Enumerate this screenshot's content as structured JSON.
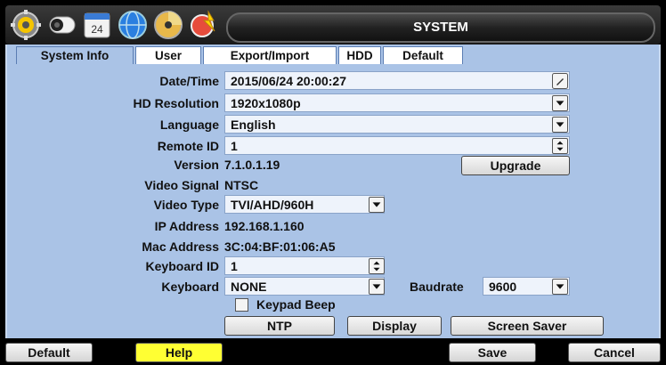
{
  "window": {
    "title": "SYSTEM"
  },
  "titlebar_icons": [
    "gear-icon",
    "camera-icon",
    "calendar-icon",
    "globe-icon",
    "disc-icon",
    "settings-icon"
  ],
  "calendar_icon_text": "24",
  "tabs": [
    {
      "label": "System Info",
      "active": true
    },
    {
      "label": "User",
      "active": false
    },
    {
      "label": "Export/Import",
      "active": false
    },
    {
      "label": "HDD",
      "active": false
    },
    {
      "label": "Default",
      "active": false
    }
  ],
  "form": {
    "datetime": {
      "label": "Date/Time",
      "value": "2015/06/24 20:00:27"
    },
    "hd_resolution": {
      "label": "HD Resolution",
      "value": "1920x1080p"
    },
    "language": {
      "label": "Language",
      "value": "English"
    },
    "remote_id": {
      "label": "Remote ID",
      "value": "1"
    },
    "version": {
      "label": "Version",
      "value": "7.1.0.1.19"
    },
    "upgrade_label": "Upgrade",
    "video_signal": {
      "label": "Video Signal",
      "value": "NTSC"
    },
    "video_type": {
      "label": "Video Type",
      "value": "TVI/AHD/960H"
    },
    "ip_address": {
      "label": "IP Address",
      "value": "192.168.1.160"
    },
    "mac_address": {
      "label": "Mac Address",
      "value": "3C:04:BF:01:06:A5"
    },
    "keyboard_id": {
      "label": "Keyboard ID",
      "value": "1"
    },
    "keyboard": {
      "label": "Keyboard",
      "value": "NONE"
    },
    "baudrate": {
      "label": "Baudrate",
      "value": "9600"
    },
    "keypad_beep": {
      "label": "Keypad Beep",
      "checked": false
    },
    "ntp_label": "NTP",
    "display_label": "Display",
    "screensaver_label": "Screen Saver"
  },
  "footer": {
    "default_label": "Default",
    "help_label": "Help",
    "save_label": "Save",
    "cancel_label": "Cancel"
  },
  "colors": {
    "panel": "#aac3e6",
    "field": "#eef3fb",
    "help_highlight": "#ffff33",
    "titlebar": "#1a1a1a"
  }
}
